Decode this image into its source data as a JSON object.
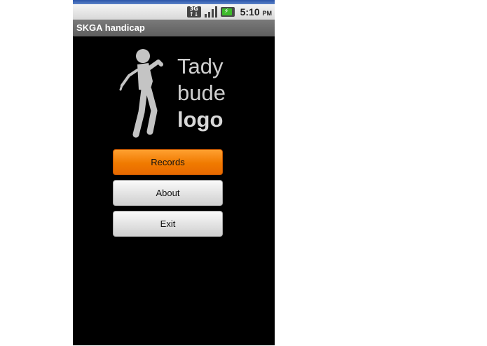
{
  "status_bar": {
    "network_icon": "3g-data-icon",
    "network_label_top": "3G",
    "network_label_bottom": "↑↓",
    "signal_icon": "signal-strength-icon",
    "battery_icon": "battery-charging-icon",
    "time": "5:10",
    "ampm": "PM"
  },
  "app": {
    "title": "SKGA handicap",
    "logo": {
      "icon": "golfer-icon",
      "line1": "Tady",
      "line2": "bude",
      "line3": "logo"
    },
    "buttons": {
      "records": "Records",
      "about": "About",
      "exit": "Exit"
    }
  },
  "colors": {
    "accent": "#f07a00",
    "background": "#000000",
    "title_bar": "#6a6a6a"
  }
}
